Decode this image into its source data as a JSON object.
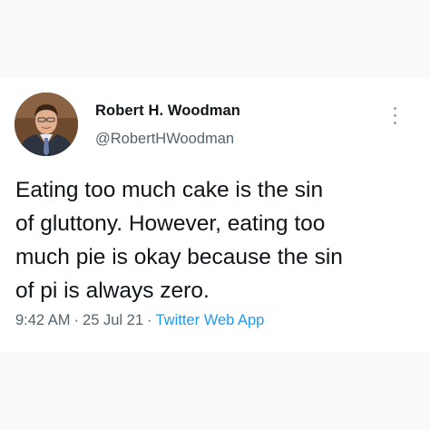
{
  "tweet": {
    "author_name": "Robert H. Woodman",
    "author_handle": "@RobertHWoodman",
    "text": "Eating too much cake is the sin\nof gluttony. However, eating too\nmuch pie is okay because the sin\nof pi is always zero.",
    "time": "9:42 AM",
    "date": "25 Jul 21",
    "separator": "·",
    "source": "Twitter Web App",
    "more_icon": "more-options-icon"
  },
  "colors": {
    "primary_text": "#0f1419",
    "secondary_text": "#536471",
    "link": "#1d9bf0",
    "background": "#ffffff"
  }
}
